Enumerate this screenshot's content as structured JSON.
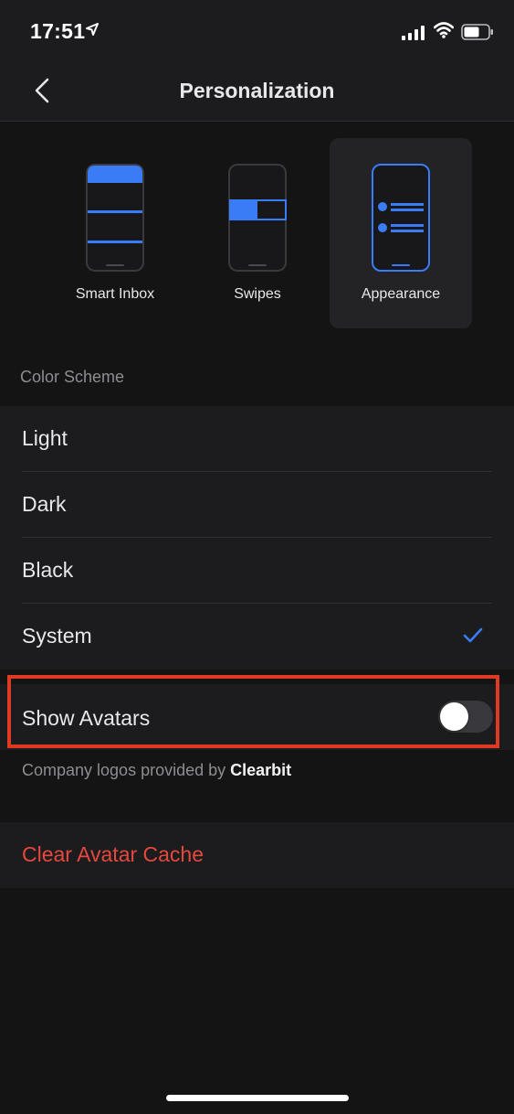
{
  "status_bar": {
    "time": "17:51",
    "icons": [
      "location-arrow-icon",
      "cellular-signal-icon",
      "wifi-icon",
      "battery-icon"
    ]
  },
  "nav": {
    "title": "Personalization",
    "back_icon": "chevron-left-icon"
  },
  "modes": [
    {
      "label": "Smart Inbox",
      "active": false
    },
    {
      "label": "Swipes",
      "active": false
    },
    {
      "label": "Appearance",
      "active": true
    }
  ],
  "color_scheme": {
    "header": "Color Scheme",
    "options": [
      {
        "label": "Light",
        "selected": false
      },
      {
        "label": "Dark",
        "selected": false
      },
      {
        "label": "Black",
        "selected": false
      },
      {
        "label": "System",
        "selected": true
      }
    ]
  },
  "avatars": {
    "label": "Show Avatars",
    "enabled": false,
    "footnote_prefix": "Company logos provided by",
    "footnote_brand": "Clearbit"
  },
  "clear_cache": {
    "label": "Clear Avatar Cache"
  },
  "colors": {
    "accent": "#3a7bf6",
    "destructive": "#e5483c",
    "highlight": "#e03a22"
  }
}
